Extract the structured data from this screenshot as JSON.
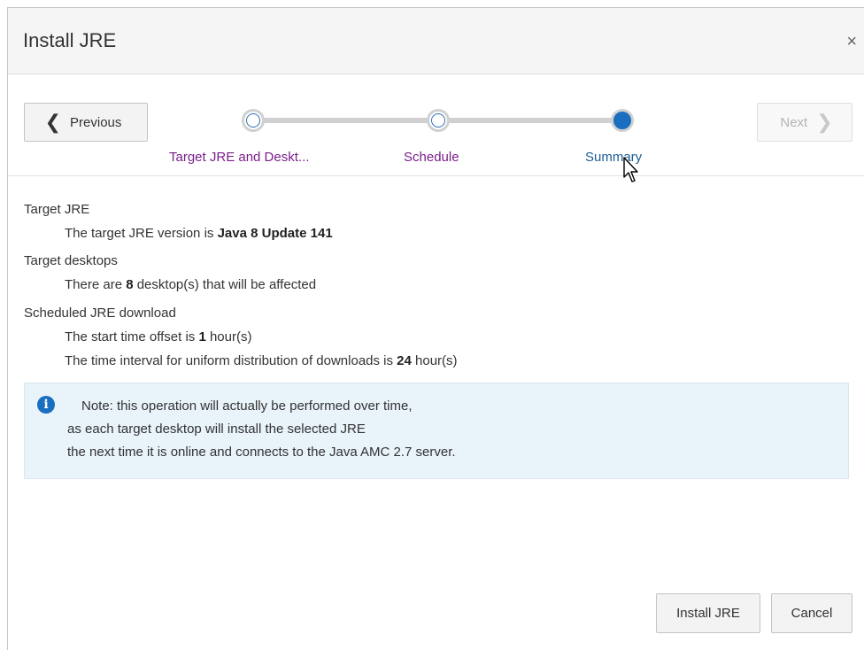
{
  "dialog": {
    "title": "Install JRE",
    "close_glyph": "×"
  },
  "train": {
    "previous_label": "Previous",
    "next_label": "Next",
    "steps": [
      {
        "label": "Target JRE and Deskt...",
        "state": "visited"
      },
      {
        "label": "Schedule",
        "state": "visited"
      },
      {
        "label": "Summary",
        "state": "current"
      }
    ]
  },
  "summary": {
    "target_jre_heading": "Target JRE",
    "target_jre_prefix": "The target JRE version is ",
    "target_jre_value": "Java 8 Update 141",
    "target_desktops_heading": "Target desktops",
    "desktops_prefix": "There are ",
    "desktops_value": "8",
    "desktops_suffix": " desktop(s) that will be affected",
    "schedule_heading": "Scheduled JRE download",
    "offset_prefix": "The start time offset is ",
    "offset_value": "1",
    "offset_suffix": " hour(s)",
    "interval_prefix": "The time interval for uniform distribution of downloads is ",
    "interval_value": "24",
    "interval_suffix": " hour(s)"
  },
  "note": {
    "icon": "info-icon",
    "line1": "Note:   this operation will actually be performed over time,",
    "line2": "as each target desktop will install the selected JRE",
    "line3": "the next time it is online and connects to the Java AMC 2.7 server."
  },
  "footer": {
    "install_label": "Install JRE",
    "cancel_label": "Cancel"
  },
  "colors": {
    "accent": "#1a6ec0",
    "visited_link": "#7a1f8a",
    "note_bg": "#e9f3fa"
  }
}
